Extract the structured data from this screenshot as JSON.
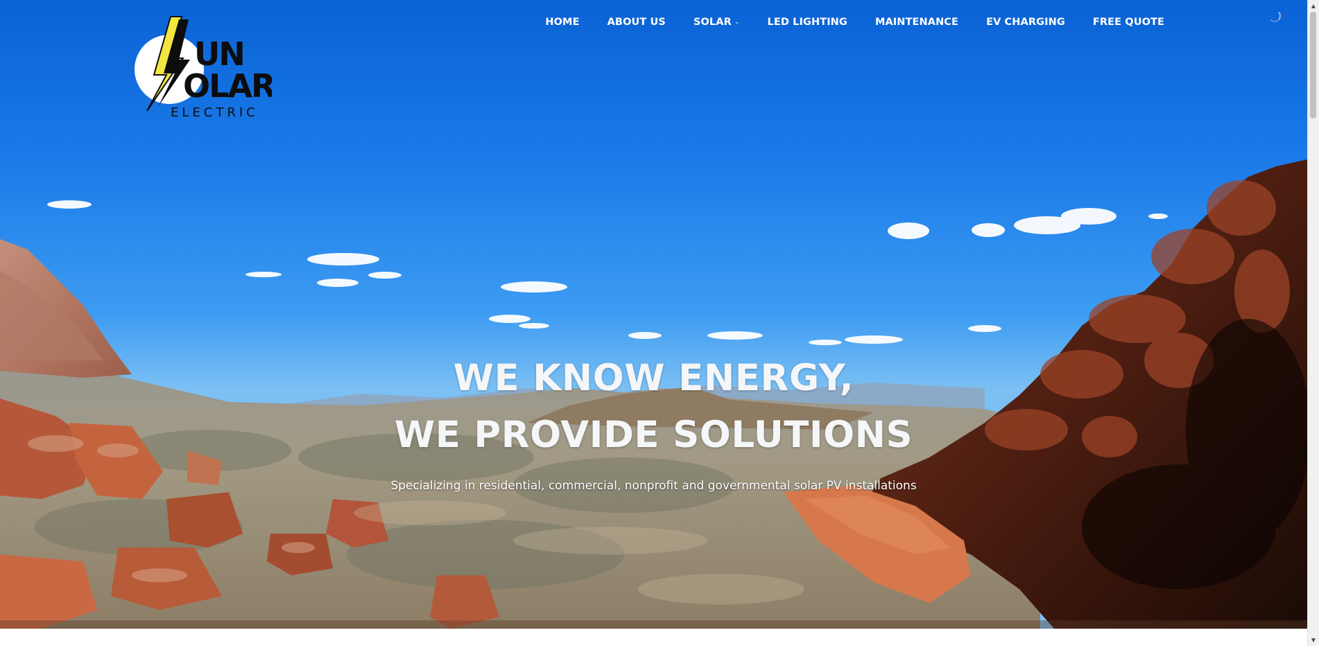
{
  "brand": {
    "logo_text_line1": "UN",
    "logo_text_line2": "OLAR",
    "logo_text_line3": "ELECTRIC",
    "colors": {
      "sky_top": "#0a64d6",
      "bolt_yellow": "#f2e640",
      "ink": "#0d0d0d"
    }
  },
  "nav": {
    "items": [
      {
        "label": "HOME",
        "has_dropdown": false
      },
      {
        "label": "ABOUT US",
        "has_dropdown": false
      },
      {
        "label": "SOLAR",
        "has_dropdown": true,
        "icon": "chevron-down-icon"
      },
      {
        "label": "LED LIGHTING",
        "has_dropdown": false
      },
      {
        "label": "MAINTENANCE",
        "has_dropdown": false
      },
      {
        "label": "EV CHARGING",
        "has_dropdown": false
      },
      {
        "label": "FREE QUOTE",
        "has_dropdown": false
      }
    ]
  },
  "hero": {
    "headline_line1": "WE KNOW ENERGY,",
    "headline_line2": "WE PROVIDE SOLUTIONS",
    "subheadline": "Specializing in residential, commercial, nonprofit and governmental solar PV installations"
  },
  "scrollbar": {
    "up_icon": "arrow-up-icon",
    "down_icon": "arrow-down-icon"
  }
}
